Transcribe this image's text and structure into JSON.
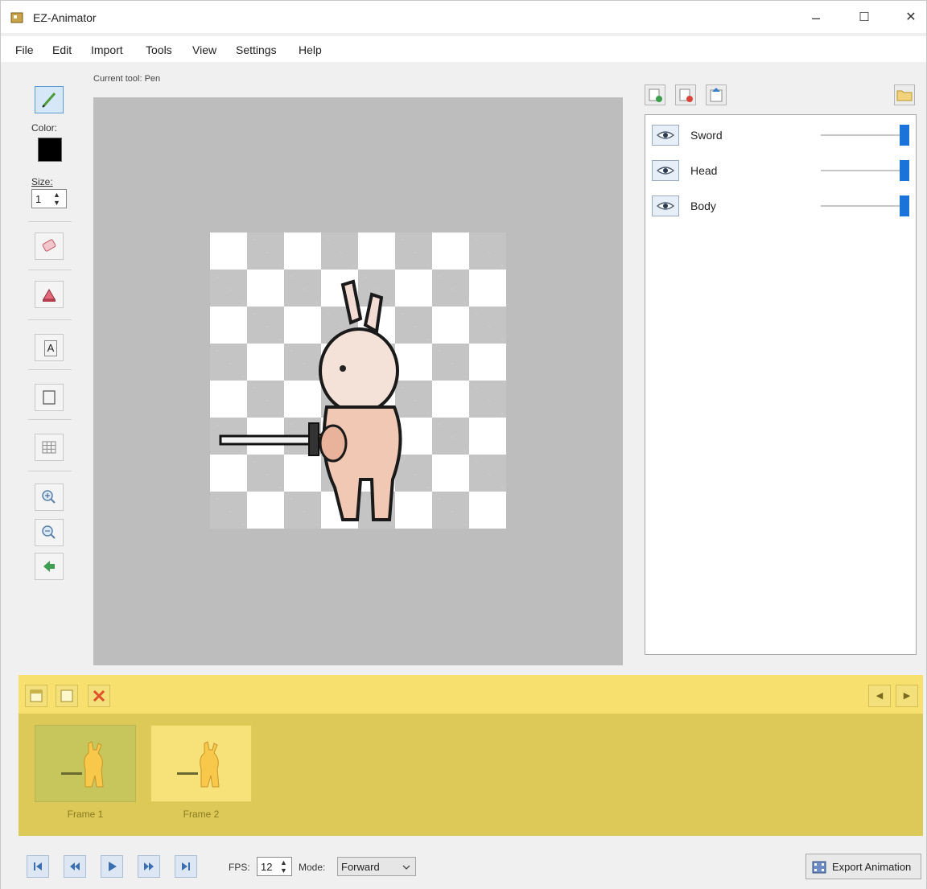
{
  "window": {
    "title": "EZ-Animator",
    "minimize": "–",
    "maximize": "☐",
    "close": "✕"
  },
  "menu": {
    "items": [
      "File",
      "Edit",
      "Import",
      "Tools",
      "View",
      "Settings",
      "Help"
    ]
  },
  "toolbox": {
    "color_label": "Color:",
    "color_value": "#000000",
    "size_label": "Size:",
    "size_value": "1",
    "text_tool_glyph": "A"
  },
  "canvas": {
    "status": "Current tool: Pen"
  },
  "layers": {
    "items": [
      {
        "name": "Sword",
        "opacity": 1.0
      },
      {
        "name": "Head",
        "opacity": 1.0
      },
      {
        "name": "Body",
        "opacity": 1.0
      }
    ]
  },
  "timeline": {
    "frames": [
      {
        "label": "Frame 1",
        "selected": true
      },
      {
        "label": "Frame 2",
        "selected": false
      }
    ],
    "prev": "◀",
    "next": "▶"
  },
  "playback": {
    "fps_label": "FPS:",
    "fps_value": "12",
    "mode_label": "Mode:",
    "mode_value": "Forward",
    "export_label": "Export Animation"
  },
  "colors": {
    "accent": "#1a73d9",
    "timeline": "#f7e06e",
    "canvas_bg": "#bdbdbd"
  }
}
